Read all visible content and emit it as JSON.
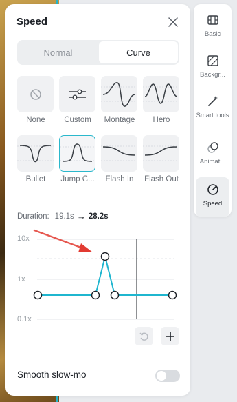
{
  "panel": {
    "title": "Speed",
    "close_icon": "close-icon"
  },
  "mode_tabs": [
    {
      "label": "Normal",
      "selected": false
    },
    {
      "label": "Curve",
      "selected": true
    }
  ],
  "presets": [
    {
      "label": "None",
      "icon": "no-symbol-icon",
      "selected": false
    },
    {
      "label": "Custom",
      "icon": "sliders-icon",
      "selected": false
    },
    {
      "label": "Montage",
      "icon": "curve-montage-icon",
      "selected": false
    },
    {
      "label": "Hero",
      "icon": "curve-hero-icon",
      "selected": false
    },
    {
      "label": "Bullet",
      "icon": "curve-bullet-icon",
      "selected": false
    },
    {
      "label": "Jump C...",
      "icon": "curve-jump-cut-icon",
      "selected": true
    },
    {
      "label": "Flash In",
      "icon": "curve-flash-in-icon",
      "selected": false
    },
    {
      "label": "Flash Out",
      "icon": "curve-flash-out-icon",
      "selected": false
    }
  ],
  "duration": {
    "label": "Duration:",
    "original": "19.1s",
    "arrow": "→",
    "new": "28.2s"
  },
  "graph": {
    "y_labels": [
      "10x",
      "1x",
      "0.1x"
    ],
    "accent": "#1fb6cf"
  },
  "graph_buttons": [
    {
      "icon": "undo-icon",
      "enabled": false
    },
    {
      "icon": "plus-icon",
      "enabled": true
    }
  ],
  "smooth_slowmo": {
    "label": "Smooth slow-mo",
    "enabled": false
  },
  "sidebar": {
    "items": [
      {
        "label": "Basic",
        "icon": "film-icon",
        "active": false
      },
      {
        "label": "Backgr...",
        "icon": "background-icon",
        "active": false
      },
      {
        "label": "Smart tools",
        "icon": "magic-wand-icon",
        "active": false
      },
      {
        "label": "Animat...",
        "icon": "animation-icon",
        "active": false
      },
      {
        "label": "Speed",
        "icon": "speedometer-icon",
        "active": true
      }
    ]
  }
}
